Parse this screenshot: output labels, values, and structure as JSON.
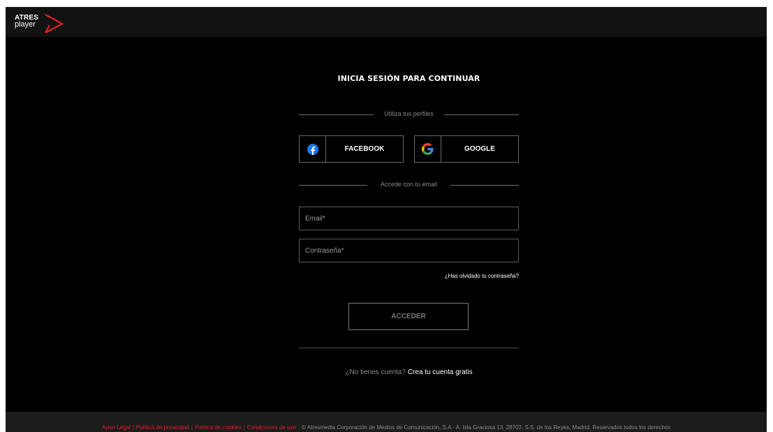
{
  "brand": {
    "line1": "ATRES",
    "line2": "player",
    "accent_color": "#e41c24"
  },
  "login": {
    "title": "INICIA SESIÓN PARA CONTINUAR",
    "profiles_label": "Utiliza tus perfiles",
    "facebook_label": "FACEBOOK",
    "facebook_icon": "facebook-icon",
    "google_label": "GOOGLE",
    "google_icon": "google-icon",
    "email_section_label": "Accede con tu email",
    "email_placeholder": "Email*",
    "email_value": "",
    "password_placeholder": "Contraseña*",
    "password_value": "",
    "forgot_label": "¿Has olvidado tu contraseña?",
    "submit_label": "ACCEDER",
    "no_account_label": "¿No tienes cuenta?",
    "create_account_label": "Crea tu cuenta gratis"
  },
  "footer": {
    "links": [
      "Aviso Legal",
      "Política de privacidad",
      "Política de cookies",
      "Condiciones de uso"
    ],
    "separator": "|",
    "copyright": "© Atresmedia Corporación de Medios de Comunicación, S.A - A. Isla Graciosa 13, 28703, S.S. de los Reyes, Madrid. Reservados todos los derechos"
  }
}
